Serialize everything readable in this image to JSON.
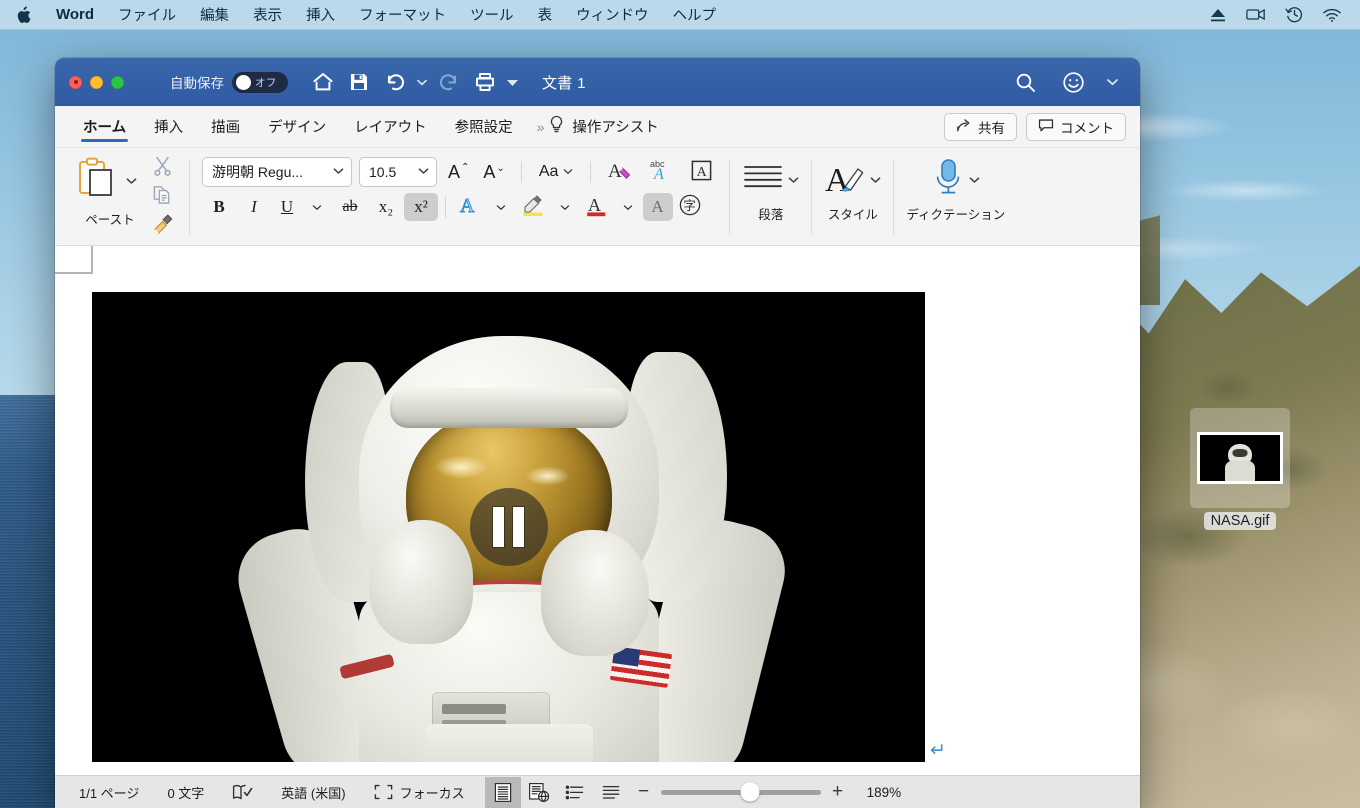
{
  "menubar": {
    "apple_icon": "apple-icon",
    "app_name": "Word",
    "items": [
      "ファイル",
      "編集",
      "表示",
      "挿入",
      "フォーマット",
      "ツール",
      "表",
      "ウィンドウ",
      "ヘルプ"
    ],
    "status_icons": [
      "eject-icon",
      "screen-record-icon",
      "time-machine-icon",
      "wifi-icon"
    ]
  },
  "window": {
    "titlebar": {
      "autosave_label": "自動保存",
      "autosave_state": "オフ",
      "quick_access": [
        "home-icon",
        "save-icon",
        "undo-icon",
        "undo-caret-icon",
        "redo-icon",
        "print-icon",
        "customize-caret-icon"
      ],
      "document_title": "文書 1",
      "right_icons": [
        "search-icon",
        "smiley-icon",
        "smiley-caret-icon"
      ]
    },
    "ribbon_tabs": {
      "tabs": [
        {
          "label": "ホーム",
          "active": true
        },
        {
          "label": "挿入",
          "active": false
        },
        {
          "label": "描画",
          "active": false
        },
        {
          "label": "デザイン",
          "active": false
        },
        {
          "label": "レイアウト",
          "active": false
        },
        {
          "label": "参照設定",
          "active": false
        }
      ],
      "overflow_chevron": "»",
      "assist_icon": "lightbulb-icon",
      "assist_label": "操作アシスト",
      "share_icon": "share-icon",
      "share_label": "共有",
      "comment_icon": "comment-icon",
      "comment_label": "コメント"
    },
    "ribbon": {
      "clipboard": {
        "paste_label": "ペースト",
        "paste_icon": "paste-clipboard-icon",
        "paste_caret": "⌄",
        "cut_icon": "scissors-icon",
        "copy_icon": "copy-icon",
        "format_painter_icon": "format-painter-icon"
      },
      "font": {
        "font_name": "游明朝 Regu...",
        "font_size": "10.5",
        "grow_font": "A",
        "grow_caret": "⌃",
        "shrink_font": "A",
        "shrink_caret": "⌄",
        "change_case": "Aa",
        "change_case_caret": "⌄",
        "clear_formatting_icon": "clear-formatting-icon",
        "phonetic_guide_icon": "phonetic-guide-icon",
        "character_border_icon": "character-border-icon",
        "bold": "B",
        "italic": "I",
        "underline": "U",
        "underline_caret": "⌄",
        "strikethrough": "ab",
        "subscript": "x₂",
        "superscript": "x²",
        "superscript_active": true,
        "text_effects_icon": "text-effects-icon",
        "text_effects_caret": "⌄",
        "highlight_icon": "highlight-icon",
        "highlight_caret": "⌄",
        "font_color_icon": "font-color-icon",
        "font_color_caret": "⌄",
        "character_shading_icon": "character-shading-icon",
        "enclose_character_icon": "enclose-character-icon"
      },
      "paragraph": {
        "icon": "paragraph-lines-icon",
        "caret": "⌄",
        "label": "段落"
      },
      "styles": {
        "icon": "styles-brush-icon",
        "caret": "⌄",
        "label": "スタイル"
      },
      "dictation": {
        "icon": "microphone-icon",
        "caret": "⌄",
        "label": "ディクテーション"
      }
    },
    "document": {
      "media_type": "animated-gif-video",
      "overlay_control": "pause-button",
      "paragraph_mark": "↵"
    },
    "statusbar": {
      "page_label": "1/1 ページ",
      "word_count": "0 文字",
      "proofing_icon": "proofing-icon",
      "language": "英語 (米国)",
      "focus_icon": "focus-icon",
      "focus_label": "フォーカス",
      "view_buttons": [
        {
          "icon": "print-layout-icon",
          "active": true
        },
        {
          "icon": "web-layout-icon",
          "active": false
        },
        {
          "icon": "outline-view-icon",
          "active": false
        },
        {
          "icon": "draft-view-icon",
          "active": false
        }
      ],
      "zoom_out": "−",
      "zoom_in": "+",
      "zoom_value": "189%"
    }
  },
  "desktop": {
    "file_icon": {
      "name": "NASA.gif",
      "selected": true,
      "thumbnail": "astronaut-thumbnail"
    }
  },
  "colors": {
    "word_title_blue": "#2f5ba3",
    "tab_accent": "#2b6cb8",
    "ribbon_bg": "#f4f4f4",
    "statusbar_bg": "#e6e6e6",
    "menubar_bg": "#c4dfee"
  }
}
